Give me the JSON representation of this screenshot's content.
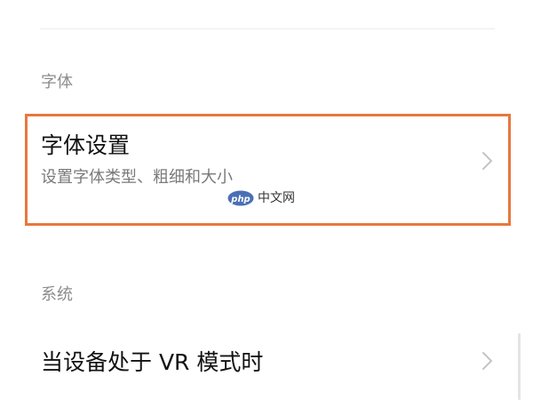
{
  "sections": [
    {
      "header": "字体",
      "item": {
        "title": "字体设置",
        "subtitle": "设置字体类型、粗细和大小"
      }
    },
    {
      "header": "系统",
      "item": {
        "title": "当设备处于 VR 模式时"
      }
    }
  ],
  "watermark": {
    "logo_text": "php",
    "text": "中文网"
  },
  "colors": {
    "highlight": "#e8773d",
    "watermark_logo": "#4a6fb5"
  },
  "icons": {
    "chevron": "chevron-right-icon"
  }
}
